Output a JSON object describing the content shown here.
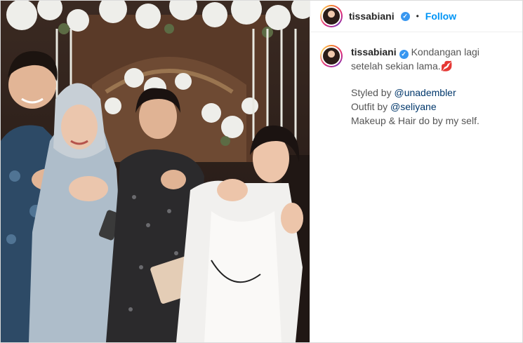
{
  "post": {
    "username": "tissabiani",
    "verified_glyph": "✓",
    "separator": "•",
    "follow_label": "Follow"
  },
  "caption": {
    "username": "tissabiani",
    "verified_glyph": "✓",
    "text": "Kondangan lagi setelah sekian lama.",
    "emoji": "💋",
    "styled_prefix": "Styled by ",
    "styled_mention": "@unadembler",
    "outfit_prefix": "Outfit by ",
    "outfit_mention": "@seliyane",
    "makeup_line": "Makeup & Hair do by my self."
  },
  "icons": {
    "verified": "verified-badge-icon",
    "avatar": "profile-avatar"
  },
  "colors": {
    "follow_blue": "#0095f6",
    "verified_blue": "#3897f0",
    "mention_blue": "#00376b"
  }
}
